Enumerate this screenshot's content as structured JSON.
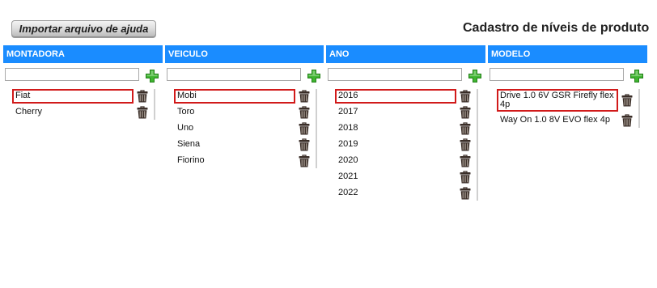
{
  "toolbar": {
    "import_help_label": "Importar arquivo de ajuda"
  },
  "page": {
    "title": "Cadastro de níveis de produto"
  },
  "colors": {
    "header_bg": "#1a8cff",
    "header_text": "#ffffff",
    "selected_border": "#d11a1a",
    "add_icon": "#3fb530",
    "delete_icon": "#3a2e28"
  },
  "icons": {
    "add": "plus-icon",
    "delete": "trash-icon"
  },
  "columns": [
    {
      "header": "MONTADORA",
      "filter_value": "",
      "items": [
        {
          "label": "Fiat",
          "selected": true
        },
        {
          "label": "Cherry",
          "selected": false
        }
      ]
    },
    {
      "header": "VEICULO",
      "filter_value": "",
      "items": [
        {
          "label": "Mobi",
          "selected": true
        },
        {
          "label": "Toro",
          "selected": false
        },
        {
          "label": "Uno",
          "selected": false
        },
        {
          "label": "Siena",
          "selected": false
        },
        {
          "label": "Fiorino",
          "selected": false
        }
      ]
    },
    {
      "header": "ANO",
      "filter_value": "",
      "items": [
        {
          "label": "2016",
          "selected": true
        },
        {
          "label": "2017",
          "selected": false
        },
        {
          "label": "2018",
          "selected": false
        },
        {
          "label": "2019",
          "selected": false
        },
        {
          "label": "2020",
          "selected": false
        },
        {
          "label": "2021",
          "selected": false
        },
        {
          "label": "2022",
          "selected": false
        }
      ]
    },
    {
      "header": "MODELO",
      "filter_value": "",
      "items": [
        {
          "label": "Drive 1.0 6V GSR Firefly flex 4p",
          "selected": true
        },
        {
          "label": "Way On 1.0 8V EVO flex 4p",
          "selected": false
        }
      ]
    }
  ]
}
